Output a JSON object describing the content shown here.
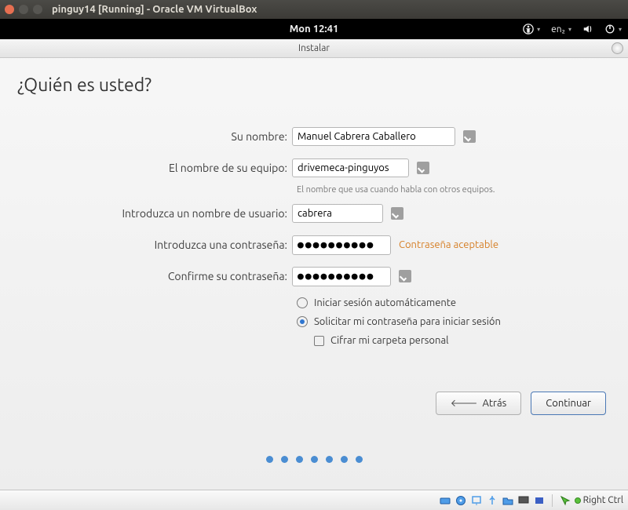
{
  "host": {
    "window_title": "pinguy14 [Running] - Oracle VM VirtualBox",
    "right_ctrl": "Right Ctrl"
  },
  "guest": {
    "clock": "Mon 12:41",
    "lang": "en₂"
  },
  "installer": {
    "title": "Instalar",
    "page_title": "¿Quién es usted?",
    "labels": {
      "name": "Su nombre:",
      "host": "El nombre de su equipo:",
      "host_hint": "El nombre que usa cuando habla con otros equipos.",
      "user": "Introduzca un nombre de usuario:",
      "pass": "Introduzca una contraseña:",
      "pass2": "Confirme su contraseña:",
      "pass_ok": "Contraseña aceptable"
    },
    "values": {
      "name": "Manuel Cabrera Caballero",
      "host": "drivemeca-pinguyos",
      "user": "cabrera",
      "pass": "●●●●●●●●●●",
      "pass2": "●●●●●●●●●●"
    },
    "options": {
      "auto_login": "Iniciar sesión automáticamente",
      "require_pw": "Solicitar mi contraseña para iniciar sesión",
      "encrypt": "Cifrar mi carpeta personal",
      "selected": "require_pw",
      "encrypt_checked": false
    },
    "buttons": {
      "back": "Atrás",
      "continue": "Continuar"
    }
  }
}
